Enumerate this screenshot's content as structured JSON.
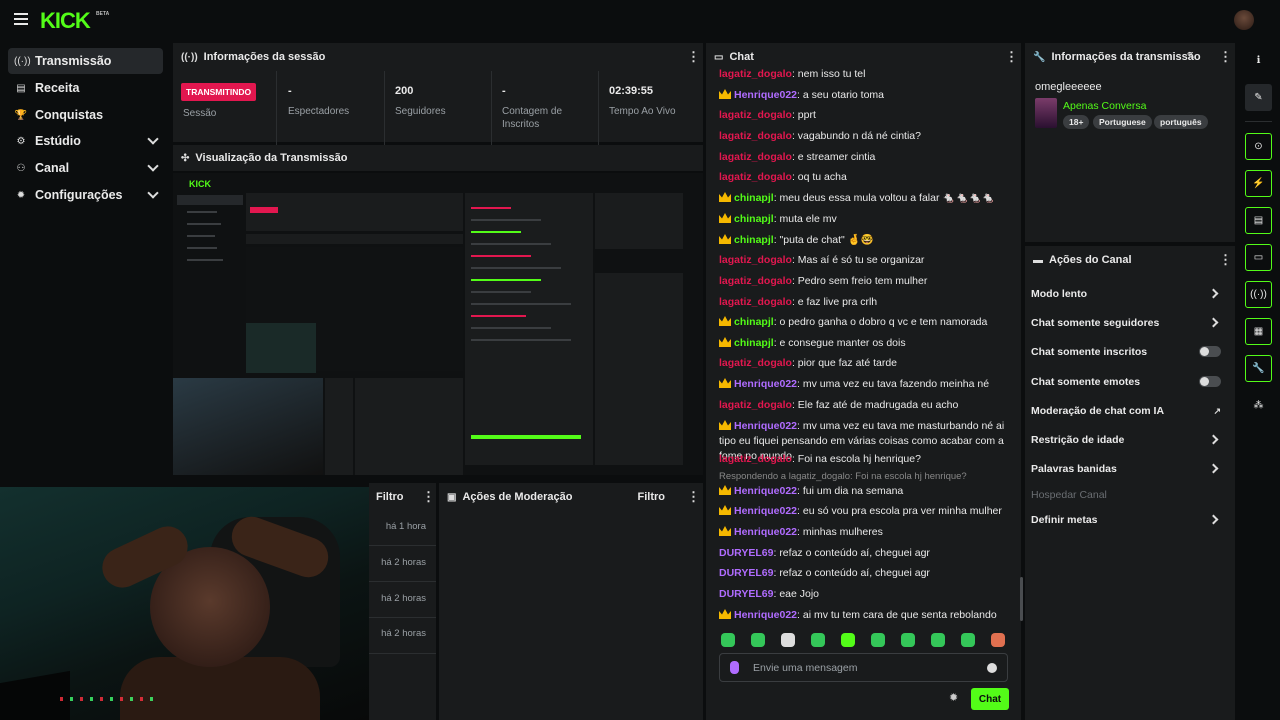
{
  "brand": {
    "logo": "KICK",
    "beta": "BETA",
    "accent": "#53fc18"
  },
  "sidebar": {
    "items": [
      {
        "label": "Transmissão",
        "icon": "broadcast-icon",
        "active": true
      },
      {
        "label": "Receita",
        "icon": "revenue-icon"
      },
      {
        "label": "Conquistas",
        "icon": "trophy-icon"
      },
      {
        "label": "Estúdio",
        "icon": "studio-icon",
        "expandable": true
      },
      {
        "label": "Canal",
        "icon": "channel-icon",
        "expandable": true
      },
      {
        "label": "Configurações",
        "icon": "gear-icon",
        "expandable": true
      }
    ]
  },
  "session": {
    "title": "Informações da sessão",
    "status_badge": "TRANSMITINDO",
    "stats": [
      {
        "value": "",
        "caption": "Sessão"
      },
      {
        "value": "-",
        "caption": "Espectadores"
      },
      {
        "value": "200",
        "caption": "Seguidores"
      },
      {
        "value": "-",
        "caption": "Contagem de Inscritos"
      },
      {
        "value": "02:39:55",
        "caption": "Tempo Ao Vivo"
      }
    ]
  },
  "preview": {
    "title": "Visualização da Transmissão"
  },
  "filtro": {
    "label": "Filtro",
    "times": [
      "há 1 hora",
      "há 2 horas",
      "há 2 horas",
      "há 2 horas"
    ]
  },
  "moderation": {
    "title": "Ações de Moderação",
    "filter_label": "Filtro"
  },
  "chat": {
    "title": "Chat",
    "messages": [
      {
        "user": "lagatiz_dogalo",
        "color": "red",
        "crown": false,
        "text": "nem isso tu tel"
      },
      {
        "user": "Henrique022",
        "color": "purple",
        "crown": true,
        "text": "a seu otario toma"
      },
      {
        "user": "lagatiz_dogalo",
        "color": "red",
        "crown": false,
        "text": "pprt"
      },
      {
        "user": "lagatiz_dogalo",
        "color": "red",
        "crown": false,
        "text": "vagabundo n dá né cintia?"
      },
      {
        "user": "lagatiz_dogalo",
        "color": "red",
        "crown": false,
        "text": "e streamer cintia"
      },
      {
        "user": "lagatiz_dogalo",
        "color": "red",
        "crown": false,
        "text": "oq tu acha"
      },
      {
        "user": "chinapjl",
        "color": "green",
        "crown": true,
        "text": "meu deus essa mula voltou a falar 🐁🐁🐁🐁"
      },
      {
        "user": "chinapjl",
        "color": "green",
        "crown": true,
        "text": "muta ele mv"
      },
      {
        "user": "chinapjl",
        "color": "green",
        "crown": true,
        "text": "\"puta de chat\" 🤞🤓"
      },
      {
        "user": "lagatiz_dogalo",
        "color": "red",
        "crown": false,
        "text": "Mas aí é só tu se organizar"
      },
      {
        "user": "lagatiz_dogalo",
        "color": "red",
        "crown": false,
        "text": "Pedro sem freio tem mulher"
      },
      {
        "user": "lagatiz_dogalo",
        "color": "red",
        "crown": false,
        "text": "e faz live pra crlh"
      },
      {
        "user": "chinapjl",
        "color": "green",
        "crown": true,
        "text": "o pedro ganha o dobro q vc e tem namorada"
      },
      {
        "user": "chinapjl",
        "color": "green",
        "crown": true,
        "text": "e consegue manter os dois"
      },
      {
        "user": "lagatiz_dogalo",
        "color": "red",
        "crown": false,
        "text": "pior que faz até tarde"
      },
      {
        "user": "Henrique022",
        "color": "purple",
        "crown": true,
        "text": "mv uma vez eu tava fazendo meinha né"
      },
      {
        "user": "lagatiz_dogalo",
        "color": "red",
        "crown": false,
        "text": "Ele faz até de madrugada eu acho"
      },
      {
        "user": "Henrique022",
        "color": "purple",
        "crown": true,
        "text": "mv uma vez eu tava me masturbando né ai tipo eu fiquei pensando em várias coisas como acabar com a fome no mundo"
      },
      {
        "user": "lagatiz_dogalo",
        "color": "red",
        "crown": false,
        "text": "Foi na escola hj henrique?"
      },
      {
        "user": "Henrique022",
        "color": "purple",
        "crown": true,
        "text": "fui um dia na semana",
        "reply": "Respondendo a lagatiz_dogalo: Foi na escola hj henrique?"
      },
      {
        "user": "Henrique022",
        "color": "purple",
        "crown": true,
        "text": "eu só vou pra escola pra ver minha mulher"
      },
      {
        "user": "Henrique022",
        "color": "purple",
        "crown": true,
        "text": "minhas mulheres"
      },
      {
        "user": "DURYEL69",
        "color": "purple",
        "crown": false,
        "text": "refaz o conteúdo aí, cheguei agr"
      },
      {
        "user": "DURYEL69",
        "color": "purple",
        "crown": false,
        "text": "refaz o conteúdo aí, cheguei agr"
      },
      {
        "user": "DURYEL69",
        "color": "purple",
        "crown": false,
        "text": "eae Jojo"
      },
      {
        "user": "Henrique022",
        "color": "purple",
        "crown": true,
        "text": "ai mv tu tem cara de que senta rebolando"
      }
    ],
    "input_placeholder": "Envie uma mensagem",
    "send_label": "Chat"
  },
  "stream_info": {
    "title": "Informações da transmissão",
    "stream_title": "omegleeeeee",
    "category": "Apenas Conversa",
    "tags": [
      "18+",
      "Portuguese",
      "português"
    ]
  },
  "channel_actions": {
    "title": "Ações do Canal",
    "rows": [
      {
        "label": "Modo lento",
        "control": "chevron"
      },
      {
        "label": "Chat somente seguidores",
        "control": "chevron"
      },
      {
        "label": "Chat somente inscritos",
        "control": "toggle"
      },
      {
        "label": "Chat somente emotes",
        "control": "toggle"
      },
      {
        "label": "Moderação de chat com IA",
        "control": "external"
      },
      {
        "label": "Restrição de idade",
        "control": "chevron"
      },
      {
        "label": "Palavras banidas",
        "control": "chevron"
      },
      {
        "label": "Hospedar Canal",
        "control": "none",
        "disabled": true
      },
      {
        "label": "Definir metas",
        "control": "chevron"
      }
    ]
  }
}
